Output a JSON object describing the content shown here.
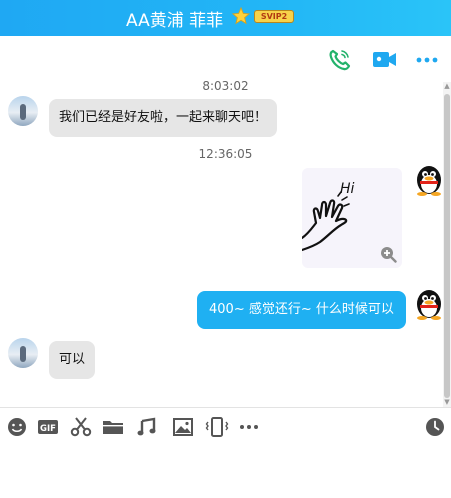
{
  "header": {
    "title": "AA黄浦  菲菲",
    "badge": "SVIP2",
    "accent_color": "#22b6f6"
  },
  "toolbar": {
    "icons": [
      "phone-icon",
      "video-call-icon",
      "more-icon"
    ]
  },
  "messages": [
    {
      "timestamp": "8:03:02"
    },
    {
      "side": "left",
      "text": "我们已经是好友啦，一起来聊天吧！"
    },
    {
      "timestamp": "12:36:05"
    },
    {
      "side": "right",
      "type": "image",
      "image_text": "Hi"
    },
    {
      "side": "right",
      "text": "400~ 感觉还行~ 什么时候可以"
    },
    {
      "side": "left",
      "text": "可以"
    }
  ],
  "input_toolbar": {
    "icons": [
      "emoji-icon",
      "gif-icon",
      "scissors-icon",
      "folder-icon",
      "music-icon",
      "image-icon",
      "shake-icon",
      "more-icon",
      "history-icon"
    ],
    "gif_label": "GIF"
  }
}
